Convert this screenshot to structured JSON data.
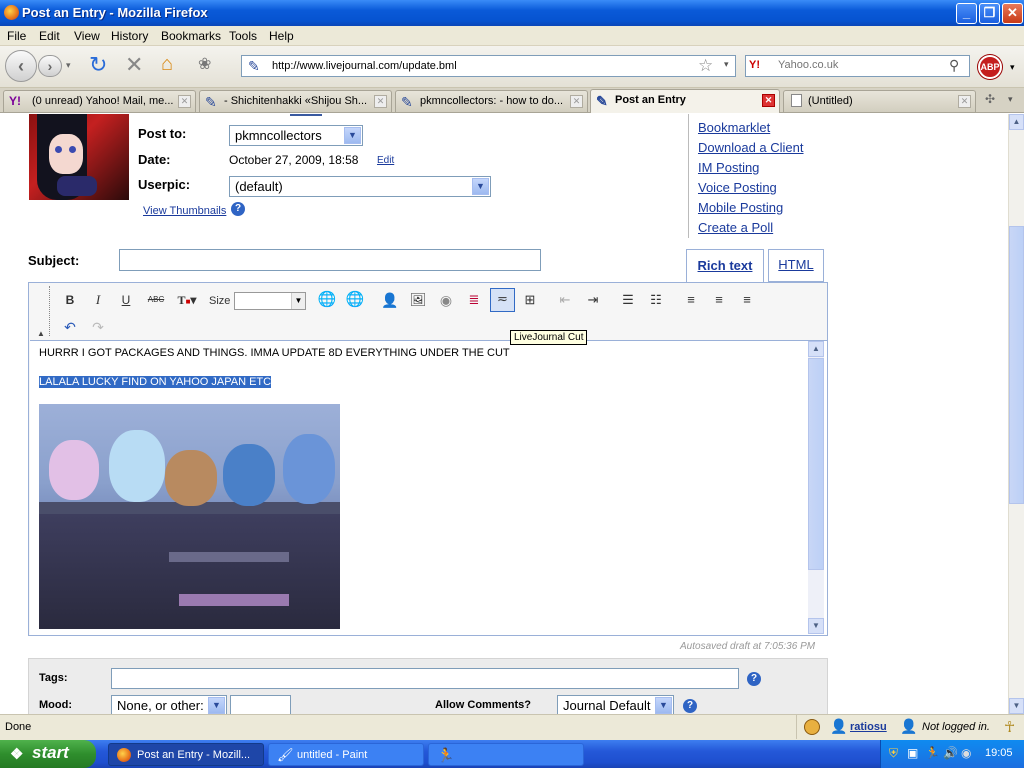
{
  "window": {
    "title": "Post an Entry - Mozilla Firefox"
  },
  "menu": [
    "File",
    "Edit",
    "View",
    "History",
    "Bookmarks",
    "Tools",
    "Help"
  ],
  "nav": {
    "url": "http://www.livejournal.com/update.bml",
    "search_placeholder": "Yahoo.co.uk",
    "search_engine": "Y!"
  },
  "tabs": [
    {
      "label": "(0 unread) Yahoo! Mail, me...",
      "icon": "yahoo-icon"
    },
    {
      "label": "- Shichitenhakki «Shijou Sh...",
      "icon": "livejournal-pencil-icon"
    },
    {
      "label": "pkmncollectors: - how to do...",
      "icon": "livejournal-pencil-icon"
    },
    {
      "label": "Post an Entry",
      "icon": "livejournal-pencil-icon",
      "active": true
    },
    {
      "label": "(Untitled)",
      "icon": "page-icon"
    }
  ],
  "form": {
    "post_to_label": "Post to:",
    "post_to_value": "pkmncollectors",
    "date_label": "Date:",
    "date_value": "October 27, 2009, 18:58",
    "edit_link": "Edit",
    "userpic_label": "Userpic:",
    "userpic_value": "(default)",
    "view_thumbnails": "View Thumbnails",
    "subject_label": "Subject:",
    "subject_value": ""
  },
  "sidebar_links": [
    "Bookmarklet",
    "Download a Client",
    "IM Posting",
    "Voice Posting",
    "Mobile Posting",
    "Create a Poll"
  ],
  "editor": {
    "tab_rich": "Rich text",
    "tab_html": "HTML",
    "size_label": "Size",
    "tooltip": "LiveJournal Cut",
    "line1": "HURRR I GOT PACKAGES AND THINGS. IMMA UPDATE 8D EVERYTHING UNDER THE CUT",
    "line2": "LALALA LUCKY FIND ON YAHOO JAPAN ETC",
    "autosave": "Autosaved draft at 7:05:36 PM"
  },
  "meta": {
    "tags_label": "Tags:",
    "mood_label": "Mood:",
    "mood_value": "None, or other:",
    "allow_comments_label": "Allow Comments?",
    "allow_comments_value": "Journal Default"
  },
  "status": {
    "text": "Done",
    "user": "ratiosu",
    "login": "Not logged in."
  },
  "taskbar": {
    "start": "start",
    "tasks": [
      "Post an Entry - Mozill...",
      "untitled - Paint"
    ],
    "clock": "19:05"
  },
  "colors": {
    "title_blue": "#0a5ad8",
    "link": "#1a3a9c",
    "selection": "#316ac5",
    "start_green": "#2f8e2d"
  }
}
